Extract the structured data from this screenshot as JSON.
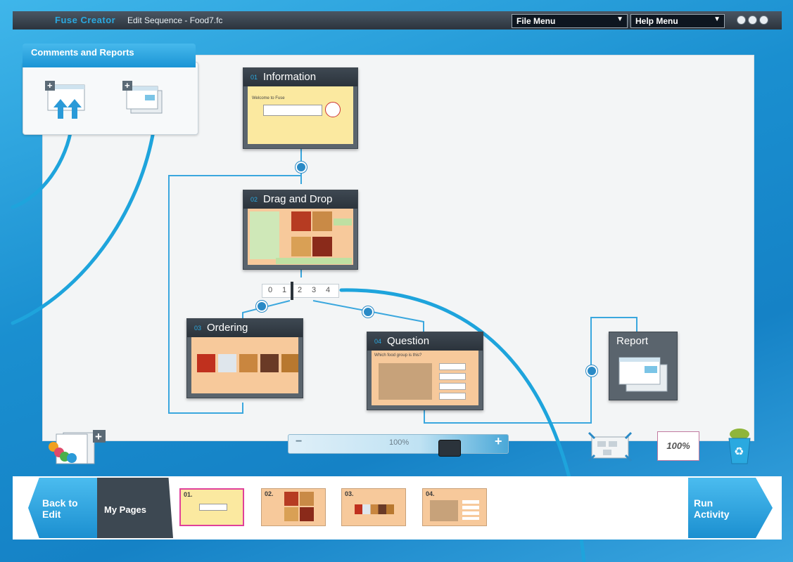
{
  "titlebar": {
    "app_name": "Fuse Creator",
    "doc_title": "Edit Sequence - Food7.fc",
    "file_menu": "File Menu",
    "help_menu": "Help Menu"
  },
  "comments_panel": {
    "title": "Comments and Reports"
  },
  "cards": {
    "information": {
      "num": "01",
      "title": "Information",
      "line1": "Welcome to Fuse"
    },
    "drag_drop": {
      "num": "02",
      "title": "Drag and Drop"
    },
    "ordering": {
      "num": "03",
      "title": "Ordering"
    },
    "question": {
      "num": "04",
      "title": "Question",
      "prompt": "Which food group is this?"
    },
    "report": {
      "title": "Report"
    }
  },
  "branch_ruler": {
    "ticks": [
      "0",
      "1",
      "2",
      "3",
      "4"
    ]
  },
  "zoom": {
    "label": "100%",
    "minus": "−",
    "plus": "+"
  },
  "footer_tools": {
    "fit_label": "100%"
  },
  "bottom_bar": {
    "back_label_1": "Back to",
    "back_label_2": "Edit",
    "mypages_label": "My Pages",
    "run_label_1": "Run",
    "run_label_2": "Activity",
    "thumbnails": [
      "01.",
      "02.",
      "03.",
      "04."
    ]
  },
  "colors": {
    "accent": "#2aa9e0",
    "connector": "#1ea4dc",
    "card_yellow": "#fbe9a0",
    "card_orange": "#f7c99b"
  }
}
